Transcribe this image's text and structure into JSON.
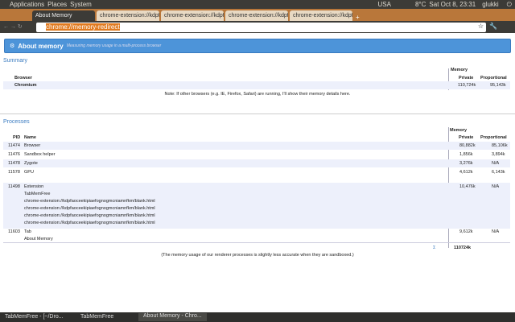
{
  "panel": {
    "menus": [
      "Applications",
      "Places",
      "System"
    ],
    "keyboard": "USA",
    "weather": "8°C",
    "clock": "Sat Oct 8, 23:31",
    "user": "glukki"
  },
  "tabs": [
    "About Memory",
    "chrome-extension://kdpf",
    "chrome-extension://kdpf",
    "chrome-extension://kdpf",
    "chrome-extension://kdpf"
  ],
  "omnibox": {
    "url": "chrome://memory-redirect"
  },
  "banner": {
    "title": "About memory",
    "subtitle": "Measuring memory usage in a multi-process browser"
  },
  "summary": {
    "title": "Summary",
    "memory": "Memory",
    "col_browser": "Browser",
    "col_private": "Private",
    "col_proportional": "Proportional",
    "rows": [
      {
        "name": "Chromium",
        "private": "110,724k",
        "proportional": "95,143k"
      }
    ],
    "note": "Note: If other browsers (e.g. IE, Firefox, Safari) are running, I'll show their memory details here."
  },
  "processes": {
    "title": "Processes",
    "memory": "Memory",
    "col_pid": "PID",
    "col_name": "Name",
    "col_private": "Private",
    "col_proportional": "Proportional",
    "rows": [
      {
        "pid": "11474",
        "name": "Browser",
        "private": "80,882k",
        "proportional": "85,106k"
      },
      {
        "pid": "11476",
        "name": "Sandbox helper",
        "private": "1,856k",
        "proportional": "3,894k"
      },
      {
        "pid": "11478",
        "name": "Zygote",
        "private": "3,276k",
        "proportional": "N/A"
      },
      {
        "pid": "11578",
        "name": "GPU",
        "private": "4,612k",
        "proportional": "6,143k"
      }
    ],
    "extension": {
      "pid": "11498",
      "name": "Extension",
      "private": "10,476k",
      "proportional": "N/A",
      "details": [
        "TabMemFree",
        "chrome-extension://kdpfaoceekipiaefognogmcniamnfkm/blank.html",
        "chrome-extension://kdpfaoceekipiaefognogmcniamnfkm/blank.html",
        "chrome-extension://kdpfaoceekipiaefognogmcniamnfkm/blank.html",
        "chrome-extension://kdpfaoceekipiaefognogmcniamnfkm/blank.html"
      ]
    },
    "tab": {
      "pid": "11603",
      "name": "Tab",
      "detail": "About Memory",
      "private": "9,612k",
      "proportional": "N/A"
    },
    "sigma": "Σ",
    "total": "110724k",
    "note": "(The memory usage of our renderer processes is slightly less accurate when they are sandboxed.)"
  },
  "taskbar": [
    "TabMemFree - [~/Dro...",
    "TabMemFree",
    "About Memory - Chro..."
  ]
}
